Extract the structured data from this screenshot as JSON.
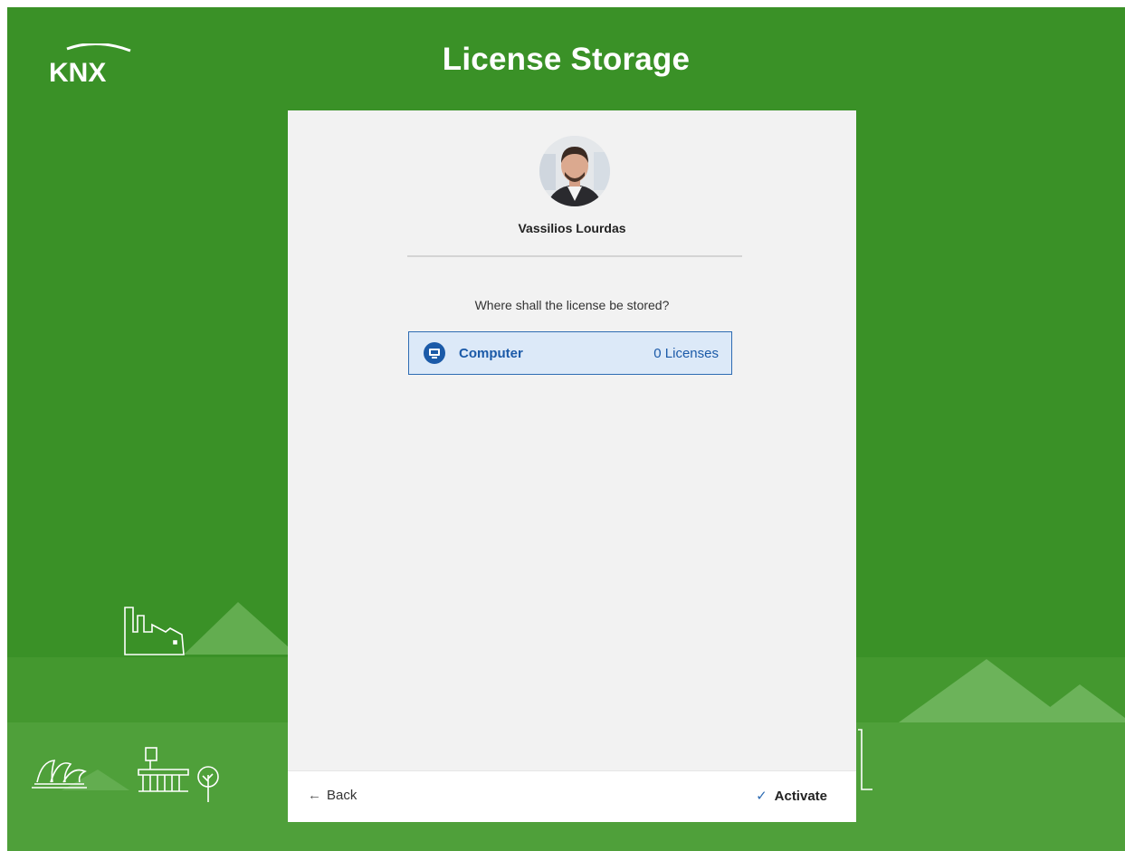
{
  "header": {
    "logo_text": "KNX",
    "title": "License Storage"
  },
  "user": {
    "name": "Vassilios Lourdas"
  },
  "prompt": "Where shall the license be stored?",
  "storage_options": [
    {
      "label": "Computer",
      "count": "0 Licenses",
      "icon": "computer-icon"
    }
  ],
  "footer": {
    "back_label": "Back",
    "activate_label": "Activate"
  },
  "colors": {
    "background": "#3a9127",
    "accent": "#2e6cb3",
    "selection": "#dce9f8"
  }
}
